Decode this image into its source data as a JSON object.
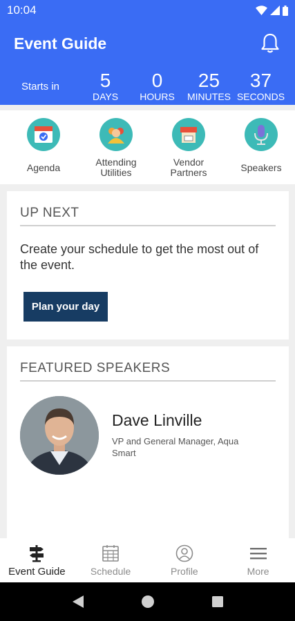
{
  "status_bar": {
    "time": "10:04"
  },
  "header": {
    "title": "Event Guide"
  },
  "countdown": {
    "label": "Starts in",
    "units": [
      {
        "value": "5",
        "label": "DAYS"
      },
      {
        "value": "0",
        "label": "HOURS"
      },
      {
        "value": "25",
        "label": "MINUTES"
      },
      {
        "value": "37",
        "label": "SECONDS"
      }
    ]
  },
  "quick_links": [
    {
      "label": "Agenda",
      "icon": "calendar-icon"
    },
    {
      "label": "Attending Utilities",
      "icon": "people-icon"
    },
    {
      "label": "Vendor Partners",
      "icon": "storefront-icon"
    },
    {
      "label": "Speakers",
      "icon": "microphone-icon"
    }
  ],
  "up_next": {
    "title": "UP NEXT",
    "text": "Create your schedule to get the most out of the event.",
    "button_label": "Plan your day"
  },
  "featured_speakers": {
    "title": "FEATURED SPEAKERS",
    "speaker": {
      "name": "Dave Linville",
      "title": "VP and General Manager, Aqua Smart"
    }
  },
  "bottom_nav": [
    {
      "label": "Event Guide",
      "icon": "signpost-icon",
      "active": true
    },
    {
      "label": "Schedule",
      "icon": "schedule-icon",
      "active": false
    },
    {
      "label": "Profile",
      "icon": "profile-icon",
      "active": false
    },
    {
      "label": "More",
      "icon": "menu-icon",
      "active": false
    }
  ],
  "colors": {
    "brand": "#3a6cf4",
    "button": "#173c63",
    "accent": "#3dbab7"
  }
}
